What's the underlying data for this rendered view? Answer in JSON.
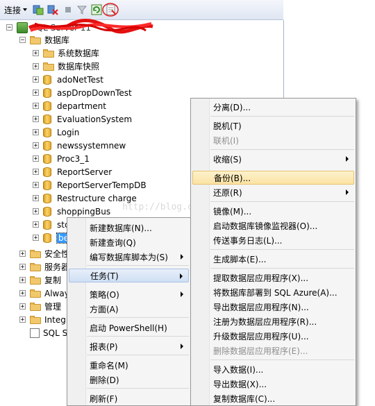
{
  "toolbar": {
    "connect_label": "连接",
    "icons": [
      "connect-icon",
      "disconnect-icon",
      "stop-icon",
      "filter-icon",
      "refresh-icon",
      "summary-icon"
    ]
  },
  "tree": {
    "server_label": "SQL Server 11",
    "databases_label": "数据库",
    "folders": [
      "系统数据库",
      "数据库快照"
    ],
    "databases": [
      "adoNetTest",
      "aspDropDownTest",
      "department",
      "EvaluationSystem",
      "Login",
      "newssystemnew",
      "Proc3_1",
      "ReportServer",
      "ReportServerTempDB",
      "Restructure charge",
      "shoppingBus",
      "stc",
      "be"
    ],
    "bottom_folders": [
      "安全性",
      "服务器",
      "复制",
      "Always",
      "管理",
      "Integr",
      "SQL S"
    ]
  },
  "watermark": "http://blog.csdn.net/",
  "context_menu": {
    "items": [
      {
        "label": "新建数据库(N)...",
        "submenu": false
      },
      {
        "label": "新建查询(Q)",
        "submenu": false
      },
      {
        "label": "编写数据库脚本为(S)",
        "submenu": true
      },
      {
        "label": "任务(T)",
        "submenu": true
      },
      {
        "label": "策略(O)",
        "submenu": true
      },
      {
        "label": "方面(A)",
        "submenu": false
      },
      {
        "label": "启动 PowerShell(H)",
        "submenu": false
      },
      {
        "label": "报表(P)",
        "submenu": true
      },
      {
        "label": "重命名(M)",
        "submenu": false
      },
      {
        "label": "删除(D)",
        "submenu": false
      },
      {
        "label": "刷新(F)",
        "submenu": false
      }
    ]
  },
  "tasks_menu": {
    "items": [
      {
        "label": "分离(D)...",
        "submenu": false,
        "disabled": false
      },
      {
        "label": "脱机(T)",
        "submenu": false,
        "disabled": false
      },
      {
        "label": "联机(I)",
        "submenu": false,
        "disabled": true
      },
      {
        "label": "收缩(S)",
        "submenu": true,
        "disabled": false
      },
      {
        "label": "备份(B)...",
        "submenu": false,
        "disabled": false
      },
      {
        "label": "还原(R)",
        "submenu": true,
        "disabled": false
      },
      {
        "label": "镜像(M)...",
        "submenu": false,
        "disabled": false
      },
      {
        "label": "启动数据库镜像监视器(O)...",
        "submenu": false,
        "disabled": false
      },
      {
        "label": "传送事务日志(L)...",
        "submenu": false,
        "disabled": false
      },
      {
        "label": "生成脚本(E)...",
        "submenu": false,
        "disabled": false
      },
      {
        "label": "提取数据层应用程序(X)...",
        "submenu": false,
        "disabled": false
      },
      {
        "label": "将数据库部署到 SQL Azure(A)...",
        "submenu": false,
        "disabled": false
      },
      {
        "label": "导出数据层应用程序(N)...",
        "submenu": false,
        "disabled": false
      },
      {
        "label": "注册为数据层应用程序(R)...",
        "submenu": false,
        "disabled": false
      },
      {
        "label": "升级数据层应用程序(U)...",
        "submenu": false,
        "disabled": false
      },
      {
        "label": "删除数据层应用程序(E)...",
        "submenu": false,
        "disabled": true
      },
      {
        "label": "导入数据(I)...",
        "submenu": false,
        "disabled": false
      },
      {
        "label": "导出数据(X)...",
        "submenu": false,
        "disabled": false
      },
      {
        "label": "复制数据库(C)...",
        "submenu": false,
        "disabled": false
      }
    ]
  }
}
